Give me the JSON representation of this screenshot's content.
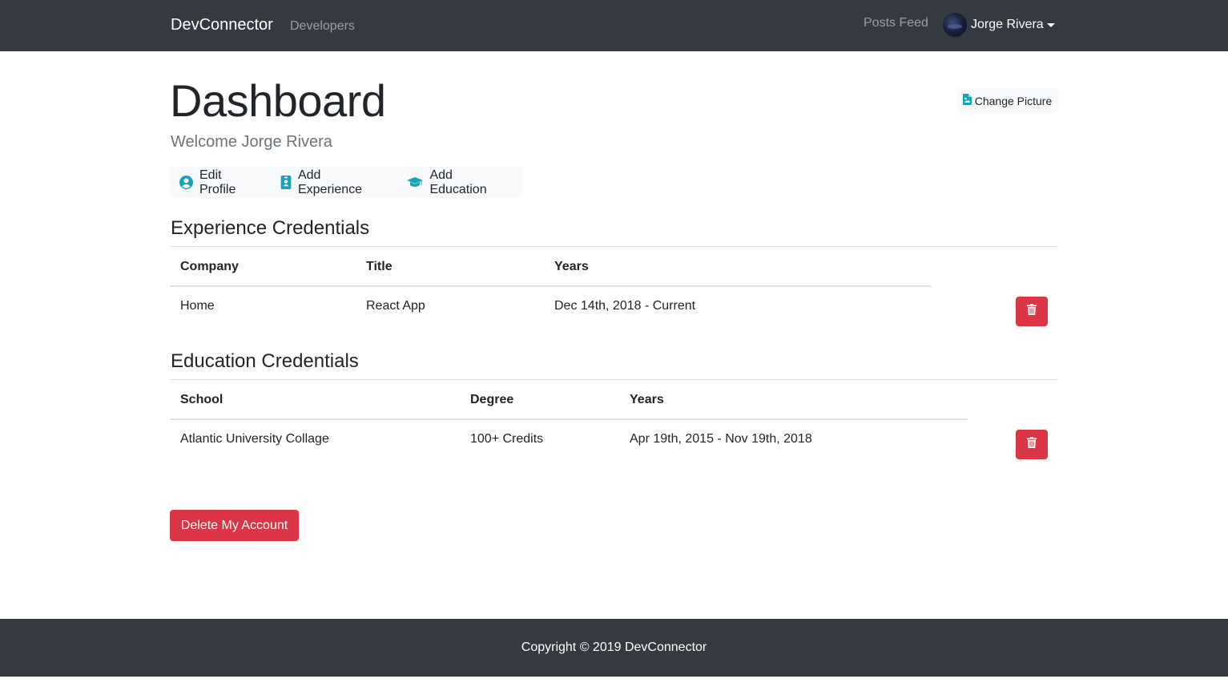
{
  "navbar": {
    "brand": "DevConnector",
    "developers_label": "Developers",
    "posts_label": "Posts Feed",
    "user_name": "Jorge Rivera"
  },
  "header": {
    "title": "Dashboard",
    "welcome": "Welcome Jorge Rivera",
    "change_picture_label": "Change Picture"
  },
  "actions": {
    "edit_profile": "Edit Profile",
    "add_experience": "Add Experience",
    "add_education": "Add Education"
  },
  "experience": {
    "title": "Experience Credentials",
    "headers": [
      "Company",
      "Title",
      "Years"
    ],
    "rows": [
      {
        "company": "Home",
        "title": "React App",
        "years": "Dec 14th, 2018 - Current"
      }
    ]
  },
  "education": {
    "title": "Education Credentials",
    "headers": [
      "School",
      "Degree",
      "Years"
    ],
    "rows": [
      {
        "school": "Atlantic University Collage",
        "degree": "100+ Credits",
        "years": "Apr 19th, 2015 - Nov 19th, 2018"
      }
    ]
  },
  "delete_account_label": "Delete My Account",
  "footer": {
    "copyright": "Copyright © 2019 DevConnector"
  },
  "colors": {
    "navbar": "#343a40",
    "danger": "#dc3545",
    "info": "#17a2b8",
    "light": "#f8f9fa"
  },
  "icons": {
    "edit_profile": "user-circle-icon",
    "add_experience": "id-badge-icon",
    "add_education": "graduation-cap-icon",
    "change_picture": "file-image-icon",
    "delete": "trash-icon"
  }
}
